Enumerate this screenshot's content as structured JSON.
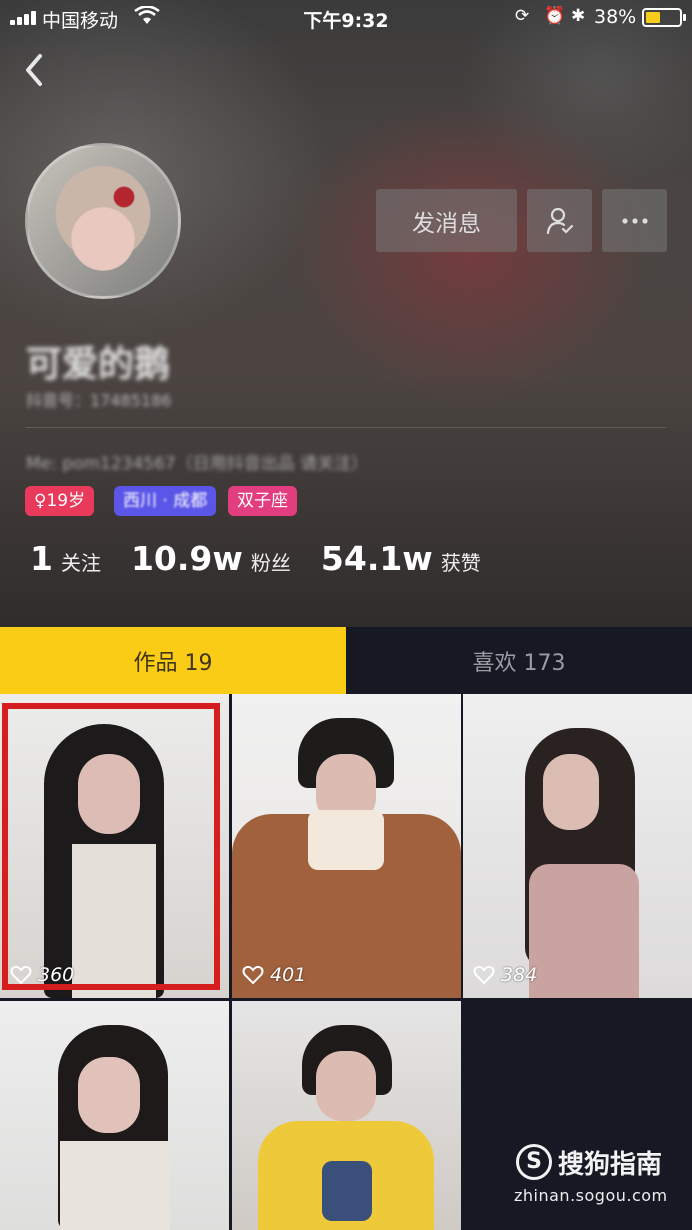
{
  "status_bar": {
    "carrier": "中国移动",
    "time": "下午9:32",
    "battery": "38%"
  },
  "profile": {
    "nickname": "可爱的鹅",
    "douyin_id": "抖音号：17485186",
    "bio": "Me: pom1234567（日用抖音出品 请关注）",
    "tags": {
      "age": "19岁",
      "location": "西川 · 成都",
      "zodiac": "双子座"
    },
    "stats": [
      {
        "value": "1",
        "label": "关注"
      },
      {
        "value": "10.9w",
        "label": "粉丝"
      },
      {
        "value": "54.1w",
        "label": "获赞"
      }
    ]
  },
  "actions": {
    "message": "发消息"
  },
  "tabs": {
    "works": "作品 19",
    "likes": "喜欢 173"
  },
  "videos": [
    {
      "likes": "360"
    },
    {
      "likes": "401"
    },
    {
      "likes": "384"
    },
    {
      "likes": ""
    },
    {
      "likes": ""
    }
  ],
  "watermark": {
    "brand": "搜狗指南",
    "url": "zhinan.sogou.com"
  }
}
